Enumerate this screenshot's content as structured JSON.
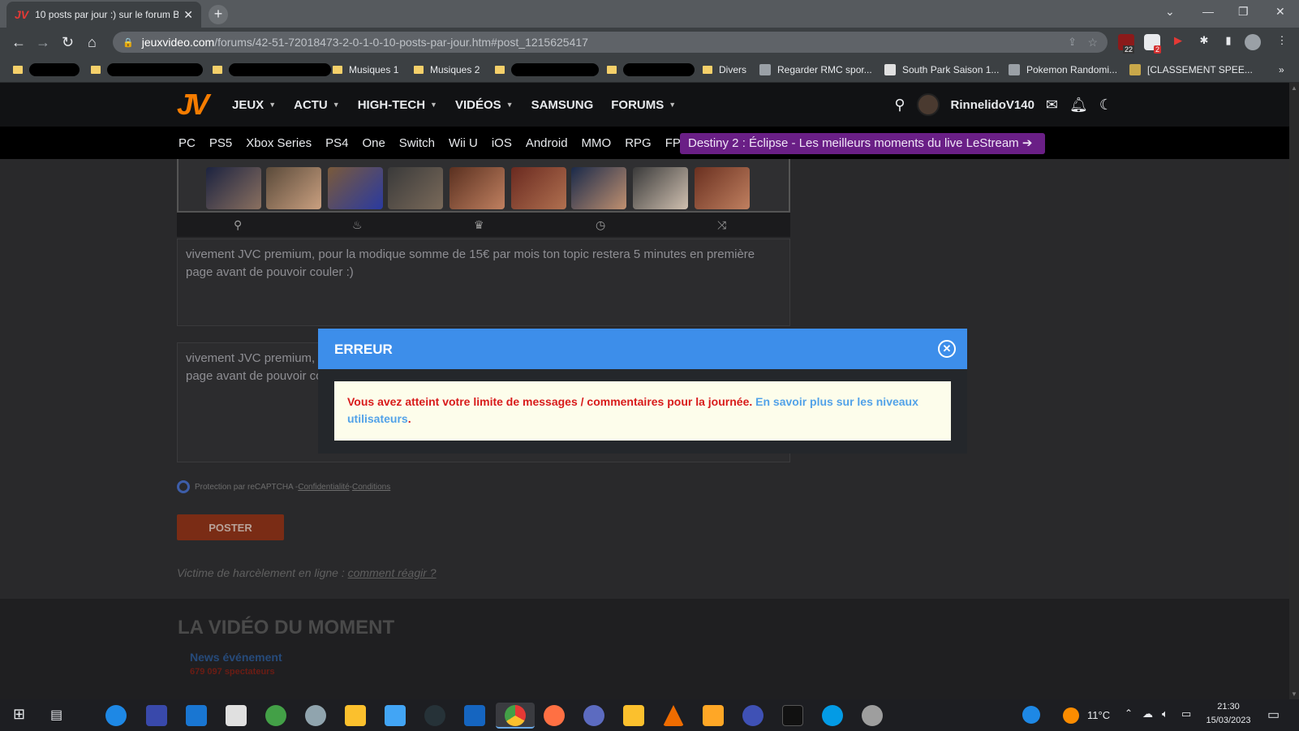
{
  "browser": {
    "tab_title": "10 posts par jour :) sur le forum B",
    "url_host": "jeuxvideo.com",
    "url_path": "/forums/42-51-72018473-2-0-1-0-10-posts-par-jour.htm#post_1215625417",
    "bookmarks": [
      "Musiques 1",
      "Musiques 2",
      "Divers",
      "Regarder RMC spor...",
      "South Park Saison 1...",
      "Pokemon Randomi...",
      "[CLASSEMENT SPEE..."
    ],
    "ext_badges": [
      "22",
      "2"
    ]
  },
  "site": {
    "logo": "JV",
    "nav": [
      "JEUX",
      "ACTU",
      "HIGH-TECH",
      "VIDÉOS",
      "SAMSUNG",
      "FORUMS"
    ],
    "username": "RinnelidoV140",
    "platforms": [
      "PC",
      "PS5",
      "Xbox Series",
      "PS4",
      "One",
      "Switch",
      "Wii U",
      "iOS",
      "Android",
      "MMO",
      "RPG",
      "FPS"
    ],
    "promo": "Destiny 2 : Éclipse - Les meilleurs moments du live LeStream"
  },
  "editor": {
    "preview_text": "vivement JVC premium, pour la modique somme de 15€ par mois ton topic restera 5 minutes en première page avant de pouvoir couler :)",
    "input_text_line1": "vivement JVC premium,",
    "input_text_line2": "page avant de pouvoir co",
    "recaptcha": "Protection par reCAPTCHA - ",
    "privacy": "Confidentialité",
    "separator": " - ",
    "terms": "Conditions",
    "post_button": "POSTER",
    "harassment_text": "Victime de harcèlement en ligne : ",
    "harassment_link": "comment réagir ?"
  },
  "video": {
    "section_title": "LA VIDÉO DU MOMENT",
    "news": "News événement",
    "spectators": "679 097 spectateurs"
  },
  "modal": {
    "title": "ERREUR",
    "message": "Vous avez atteint votre limite de messages / commentaires pour la journée.",
    "link_text": "En savoir plus sur les niveaux utilisateurs",
    "period": "."
  },
  "taskbar": {
    "temperature": "11°C",
    "time": "21:30",
    "date": "15/03/2023"
  },
  "colors": {
    "modal_header": "#3d8eea",
    "error_text": "#d81b1b",
    "link": "#52a2e8",
    "promo_bg": "#6a1f86",
    "post_button": "#7a2c15"
  }
}
